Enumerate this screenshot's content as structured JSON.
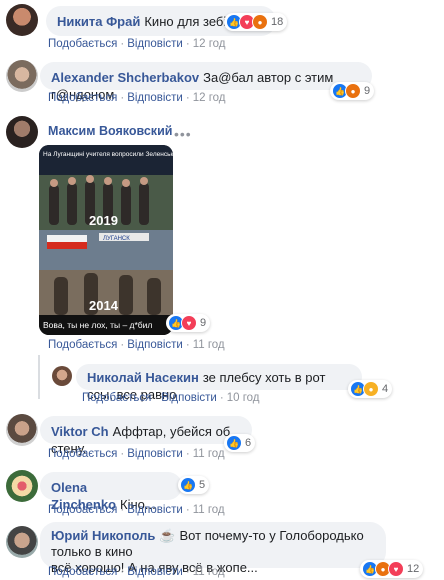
{
  "comments": [
    {
      "name": "Никита Фрай",
      "text": "Кино для зебілів.",
      "like": "Подобається",
      "reply": "Відповісти",
      "time": "12 год",
      "reactions": "18"
    },
    {
      "name": "Alexander Shcherbakov",
      "text": "За@бал автор с этим г@ндоном",
      "like": "Подобається",
      "reply": "Відповісти",
      "time": "12 год",
      "reactions": "9"
    },
    {
      "name": "Максим Вояковский",
      "like": "Подобається",
      "reply": "Відповісти",
      "time": "11 год",
      "reactions": "9",
      "image": {
        "caption_top": "На Луганщині учителя вопросили Зеленського отвести ВСУ",
        "year_top": "2019",
        "sign": "ЛУГАНСК",
        "year_bottom": "2014",
        "caption_bottom": "Вова, ты не лох, ты – д*бил"
      }
    },
    {
      "name": "Николай Насекин",
      "text": "зе плебсу хоть в рот ссы, все равно",
      "like": "Подобається",
      "reply": "Відповісти",
      "time": "10 год",
      "reactions": "4"
    },
    {
      "name": "Viktor Ch",
      "text": "Аффтар, убейся об стену.",
      "like": "Подобається",
      "reply": "Відповісти",
      "time": "11 год",
      "reactions": "6"
    },
    {
      "name": "Olena Zinchenko",
      "text": "Кіно...",
      "like": "Подобається",
      "reply": "Відповісти",
      "time": "11 год",
      "reactions": "5"
    },
    {
      "name": "Юрий Никополь",
      "text_line1": "Вот почему-то у Голобородько только в кино",
      "text_line2": "всё хорошо! А на яву всё в жопе...",
      "like": "Подобається",
      "reply": "Відповісти",
      "time": "11 год",
      "reactions": "12"
    }
  ],
  "more_icon": "ellipsis-icon",
  "colors": {
    "name": "#385898",
    "bubble": "#f0f2f5",
    "like": "#1877f2",
    "angry": "#e9710f",
    "love": "#f33e58",
    "haha": "#f7b125"
  }
}
